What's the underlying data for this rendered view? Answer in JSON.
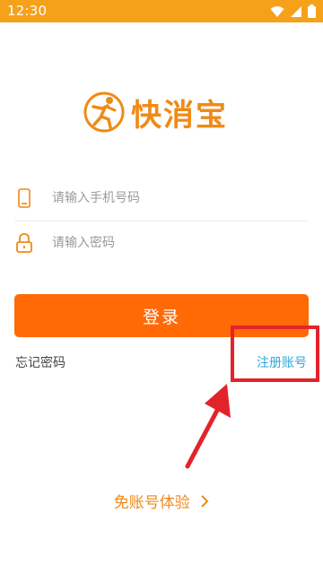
{
  "status_bar": {
    "time": "12:30",
    "icons": [
      "wifi-icon",
      "cellular-signal-icon",
      "battery-icon"
    ],
    "color": "#f5a11a"
  },
  "logo": {
    "text": "快消宝",
    "icon": "running-man-logo-icon",
    "color": "#f08a17"
  },
  "form": {
    "phone_placeholder": "请输入手机号码",
    "phone_value": "",
    "password_placeholder": "请输入密码",
    "password_value": "",
    "phone_icon": "phone-icon",
    "password_icon": "lock-icon"
  },
  "actions": {
    "login_label": "登录",
    "login_color": "#ff6a07",
    "forgot_password": "忘记密码",
    "register": "注册账号",
    "register_color": "#2fa7dc",
    "guest_label": "免账号体验"
  },
  "annotation": {
    "highlight_color": "#e3232b"
  }
}
